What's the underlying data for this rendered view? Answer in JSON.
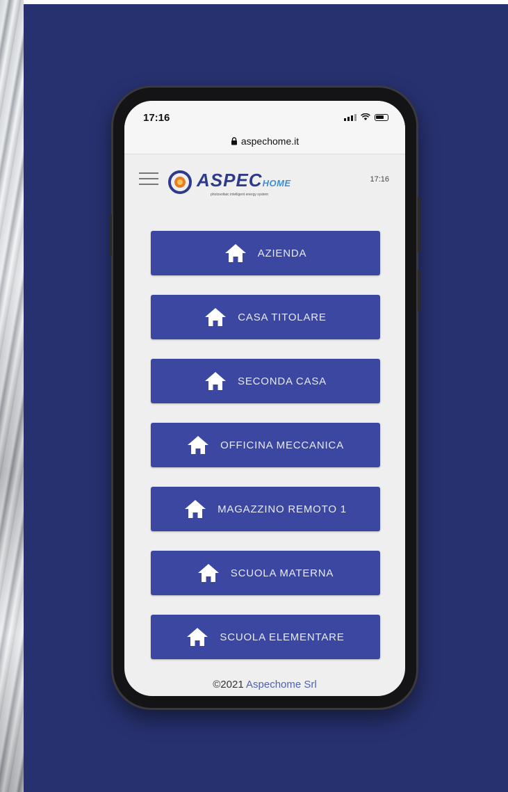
{
  "status_bar": {
    "time": "17:16"
  },
  "browser": {
    "url": "aspechome.it",
    "lock_icon": "lock-icon"
  },
  "app_header": {
    "menu_icon": "hamburger-menu-icon",
    "logo": {
      "text_main": "ASPEC",
      "text_sub": "HOME",
      "tagline": "photovoltaic intelligent energy system"
    },
    "time": "17:16"
  },
  "menu": {
    "icon": "home-icon",
    "items": [
      {
        "label": "AZIENDA"
      },
      {
        "label": "CASA TITOLARE"
      },
      {
        "label": "SECONDA CASA"
      },
      {
        "label": "OFFICINA MECCANICA"
      },
      {
        "label": "MAGAZZINO REMOTO 1"
      },
      {
        "label": "SCUOLA MATERNA"
      },
      {
        "label": "SCUOLA ELEMENTARE"
      }
    ]
  },
  "footer": {
    "copyright": "©2021",
    "company": "Aspechome Srl"
  },
  "colors": {
    "background": "#27316f",
    "button": "#3b47a0",
    "screen": "#efefef",
    "logo_blue": "#2e3a8c",
    "logo_orange": "#e67e22"
  }
}
